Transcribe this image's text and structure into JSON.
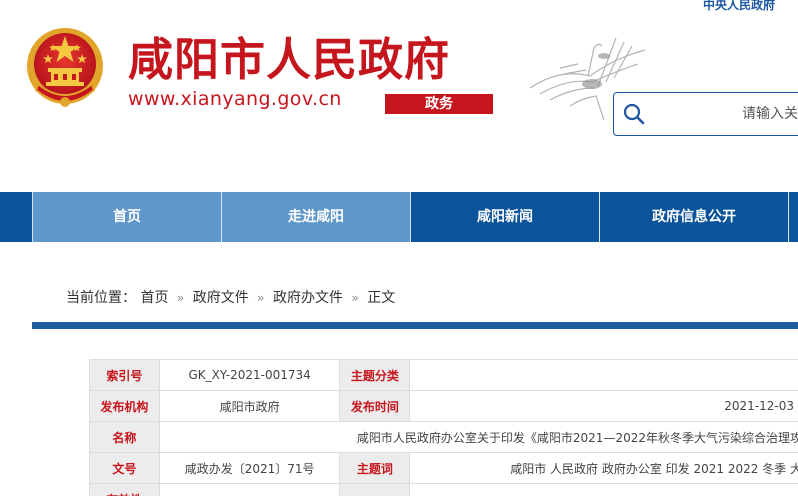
{
  "header": {
    "top_link": "中央人民政府",
    "site_name": "咸阳市人民政府",
    "site_url": "www.xianyang.gov.cn",
    "site_tag": "政务",
    "emblem_icon": "national-emblem-icon",
    "cranes_icon": "cranes-icon",
    "search": {
      "placeholder": "请输入关",
      "icon": "search-icon"
    }
  },
  "colors": {
    "brand_red": "#c6161d",
    "nav_blue": "#0b539b",
    "nav_active": "#5e97c9",
    "rule_blue": "#1d5c9d"
  },
  "nav": {
    "items": [
      {
        "label": "首页"
      },
      {
        "label": "走进咸阳"
      },
      {
        "label": "咸阳新闻"
      },
      {
        "label": "政府信息公开"
      }
    ]
  },
  "breadcrumb": {
    "prefix": "当前位置：",
    "separator": "»",
    "items": [
      "首页",
      "政府文件",
      "政府办文件",
      "正文"
    ]
  },
  "doc_info": {
    "index_label": "索引号",
    "index_value": "GK_XY-2021-001734",
    "topic_label": "主题分类",
    "topic_value": "",
    "publisher_label": "发布机构",
    "publisher_value": "咸阳市政府",
    "date_label": "发布时间",
    "date_value": "2021-12-03",
    "name_label": "名称",
    "name_value": "咸阳市人民政府办公室关于印发《咸阳市2021—2022年秋冬季大气污染综合治理攻",
    "docno_label": "文号",
    "docno_value": "咸政办发〔2021〕71号",
    "keywords_label": "主题词",
    "keywords_value": "咸阳市 人民政府 政府办公室 印发 2021 2022 冬季 大",
    "next_label": "有效性"
  }
}
